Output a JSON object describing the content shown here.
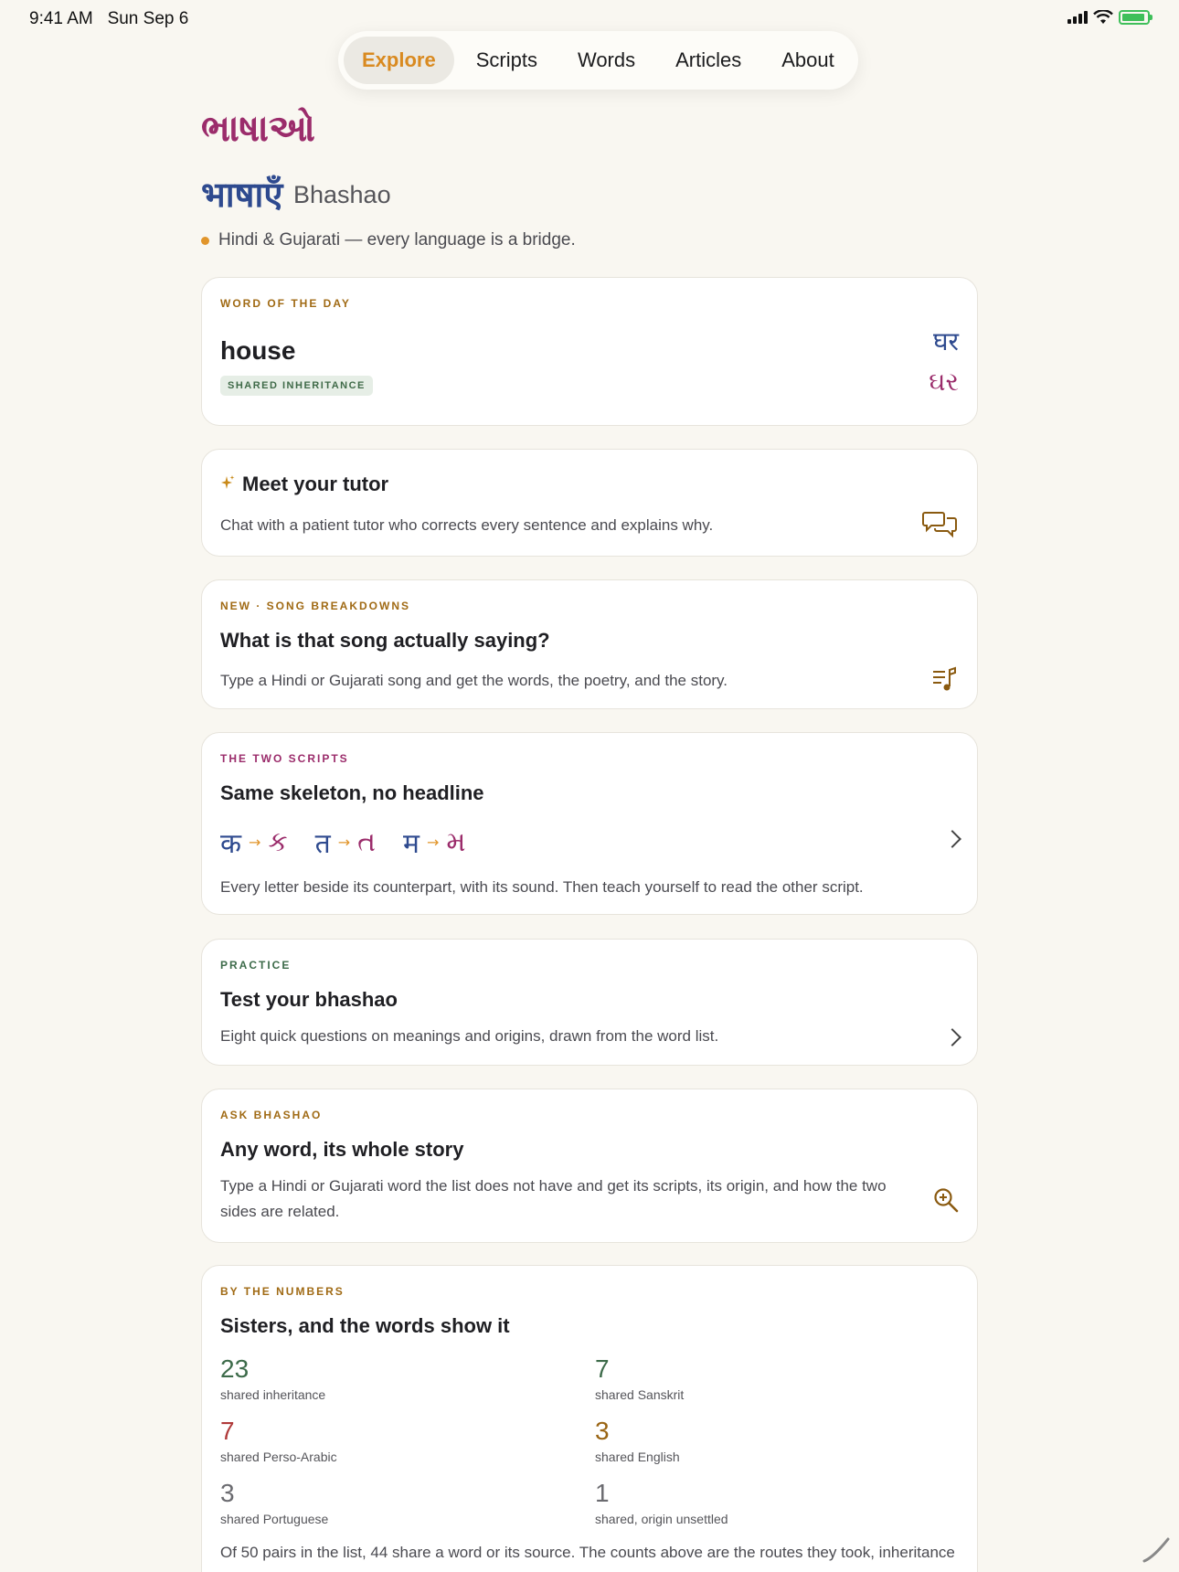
{
  "status_bar": {
    "time": "9:41 AM",
    "date": "Sun Sep 6"
  },
  "nav": {
    "items": [
      "Explore",
      "Scripts",
      "Words",
      "Articles",
      "About"
    ],
    "active": "Explore"
  },
  "header": {
    "title_gujarati": "ભાષાઓ",
    "title_hindi": "भाषाएँ",
    "title_latin": "Bhashao",
    "tagline": "Hindi & Gujarati — every language is a bridge."
  },
  "word_of_day": {
    "kicker": "WORD OF THE DAY",
    "word": "house",
    "badge": "SHARED INHERITANCE",
    "hindi": "घर",
    "gujarati": "ઘર"
  },
  "tutor": {
    "title": "Meet your tutor",
    "desc": "Chat with a patient tutor who corrects every sentence and explains why.",
    "icon": "chat-bubbles-icon"
  },
  "songs": {
    "kicker": "NEW · SONG BREAKDOWNS",
    "title": "What is that song actually saying?",
    "desc": "Type a Hindi or Gujarati song and get the words, the poetry, and the story.",
    "icon": "music-list-icon"
  },
  "scripts": {
    "kicker": "THE TWO SCRIPTS",
    "title": "Same skeleton, no headline",
    "pairs": [
      {
        "hindi": "क",
        "gujarati": "ક"
      },
      {
        "hindi": "त",
        "gujarati": "ત"
      },
      {
        "hindi": "म",
        "gujarati": "મ"
      }
    ],
    "arrow": "→",
    "desc": "Every letter beside its counterpart, with its sound. Then teach yourself to read the other script."
  },
  "practice": {
    "kicker": "PRACTICE",
    "title": "Test your bhashao",
    "desc": "Eight quick questions on meanings and origins, drawn from the word list."
  },
  "ask": {
    "kicker": "ASK BHASHAO",
    "title": "Any word, its whole story",
    "desc": "Type a Hindi or Gujarati word the list does not have and get its scripts, its origin, and how the two sides are related.",
    "icon": "search-plus-icon"
  },
  "numbers": {
    "kicker": "BY THE NUMBERS",
    "title": "Sisters, and the words show it",
    "stats": [
      {
        "value": "23",
        "label": "shared inheritance",
        "color": "#3d6b4a"
      },
      {
        "value": "7",
        "label": "shared Sanskrit",
        "color": "#3d6b4a"
      },
      {
        "value": "7",
        "label": "shared Perso-Arabic",
        "color": "#b03a3a"
      },
      {
        "value": "3",
        "label": "shared English",
        "color": "#9a6514"
      },
      {
        "value": "3",
        "label": "shared Portuguese",
        "color": "#6b6b70"
      },
      {
        "value": "1",
        "label": "shared, origin unsettled",
        "color": "#6b6b70"
      }
    ],
    "summary": "Of 50 pairs in the list, 44 share a word or its source. The counts above are the routes they took, inheritance"
  },
  "colors": {
    "accent": "#d98a20",
    "hindi": "#2e4a8f",
    "gujarati": "#9b2c6b",
    "background": "#f9f7f1"
  }
}
